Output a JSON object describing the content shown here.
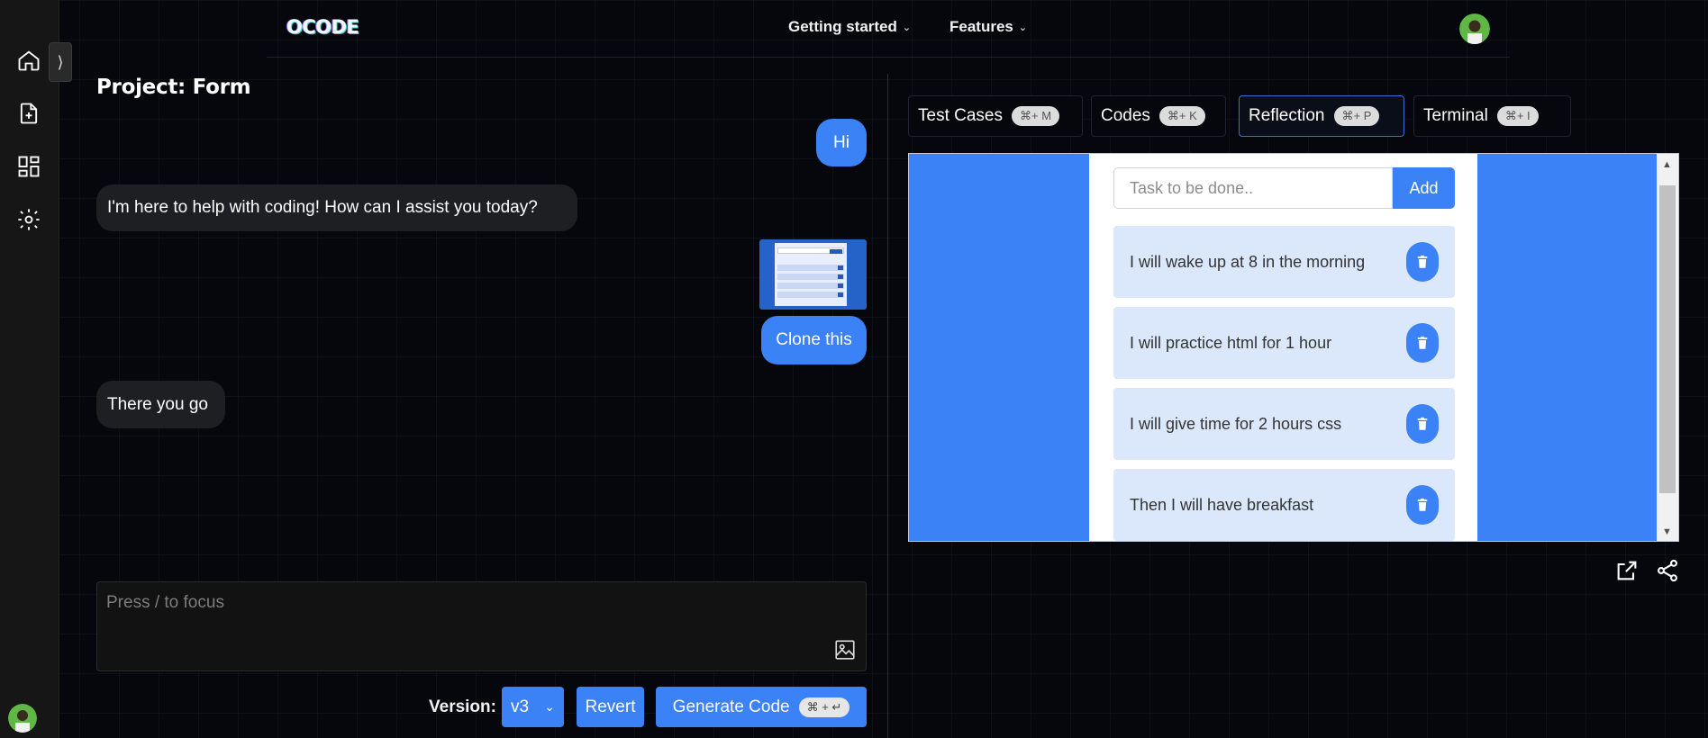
{
  "header": {
    "logo": "OCODE",
    "menu": [
      {
        "label": "Getting started"
      },
      {
        "label": "Features"
      }
    ]
  },
  "sidebar": {
    "items": [
      "home-icon",
      "new-file-icon",
      "dashboard-icon",
      "settings-icon"
    ],
    "toggle": "⟩"
  },
  "project": {
    "title": "Project: Form"
  },
  "chat": {
    "messages": [
      {
        "role": "user",
        "text": "Hi"
      },
      {
        "role": "assistant",
        "text": "I'm here to help with coding! How can I assist you today?"
      },
      {
        "role": "user",
        "text": "Clone this"
      },
      {
        "role": "assistant",
        "text": "There you go"
      }
    ]
  },
  "prompt": {
    "placeholder": "Press / to focus"
  },
  "footer": {
    "version_label": "Version:",
    "version_value": "v3",
    "revert_label": "Revert",
    "generate_label": "Generate Code",
    "generate_shortcut": "⌘ + ↵"
  },
  "tabs": [
    {
      "label": "Test Cases",
      "shortcut": "⌘+ M"
    },
    {
      "label": "Codes",
      "shortcut": "⌘+ K"
    },
    {
      "label": "Reflection",
      "shortcut": "⌘+ P"
    },
    {
      "label": "Terminal",
      "shortcut": "⌘+ I"
    }
  ],
  "active_tab": "Reflection",
  "preview": {
    "input_placeholder": "Task to be done..",
    "add_label": "Add",
    "tasks": [
      "I will wake up at 8 in the morning",
      "I will practice html for 1 hour",
      "I will give time for 2 hours css",
      "Then I will have breakfast"
    ]
  },
  "colors": {
    "accent": "#3b82f6",
    "background": "#05070d",
    "rail": "#161616"
  }
}
